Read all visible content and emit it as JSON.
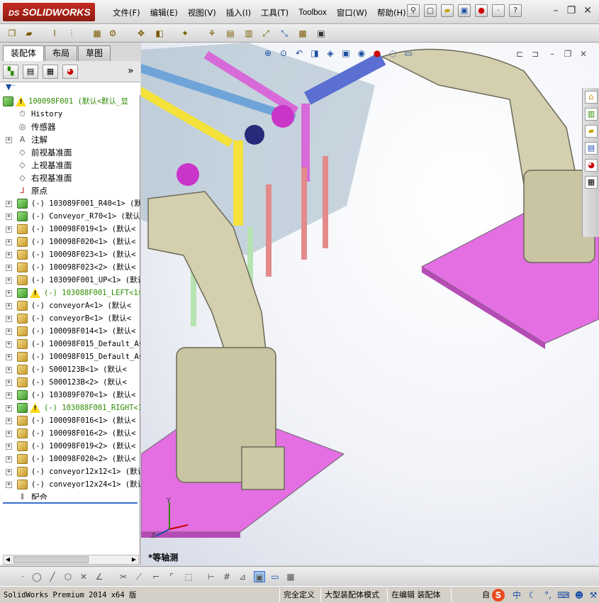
{
  "app": {
    "logo_ds": "DS",
    "logo_text": "SOLIDWORKS"
  },
  "menu": [
    {
      "label": "文件(F)"
    },
    {
      "label": "编辑(E)"
    },
    {
      "label": "视图(V)"
    },
    {
      "label": "插入(I)"
    },
    {
      "label": "工具(T)"
    },
    {
      "label": "Toolbox"
    },
    {
      "label": "窗口(W)"
    },
    {
      "label": "帮助(H)"
    }
  ],
  "panel": {
    "tabs": [
      {
        "label": "装配体"
      },
      {
        "label": "布局"
      },
      {
        "label": "草图"
      }
    ],
    "expand_glyph": "»"
  },
  "tree": {
    "root": "100098F001  (默认<默认_显",
    "items": [
      {
        "label": "History",
        "kind": "history"
      },
      {
        "label": "传感器",
        "kind": "sensor"
      },
      {
        "label": "注解",
        "kind": "annotation",
        "exp": true
      },
      {
        "label": "前视基准面",
        "kind": "plane"
      },
      {
        "label": "上视基准面",
        "kind": "plane"
      },
      {
        "label": "右视基准面",
        "kind": "plane"
      },
      {
        "label": "原点",
        "kind": "origin"
      },
      {
        "label": "(-) 103089F001_R40<1> (默",
        "kind": "asm",
        "exp": true
      },
      {
        "label": "(-) Conveyor_R70<1> (默认",
        "kind": "asm",
        "exp": true
      },
      {
        "label": "(-) 100098F019<1> (默认<",
        "kind": "part",
        "exp": true
      },
      {
        "label": "(-) 100098F020<1> (默认<",
        "kind": "part",
        "exp": true
      },
      {
        "label": "(-) 100098F023<1> (默认<",
        "kind": "part",
        "exp": true
      },
      {
        "label": "(-) 100098F023<2> (默认<",
        "kind": "part",
        "exp": true
      },
      {
        "label": "(-) 103090F001_UP<1> (默认",
        "kind": "part",
        "exp": true
      },
      {
        "label": "(-) 103088F001_LEFT<1>",
        "kind": "warn",
        "exp": true
      },
      {
        "label": "(-) conveyorA<1> (默认<",
        "kind": "part",
        "exp": true
      },
      {
        "label": "(-) conveyorB<1> (默认<",
        "kind": "part",
        "exp": true
      },
      {
        "label": "(-) 100098F014<1> (默认<",
        "kind": "part",
        "exp": true
      },
      {
        "label": "(-) 100098F015_Default_As",
        "kind": "part",
        "exp": true
      },
      {
        "label": "(-) 100098F015_Default_As",
        "kind": "part",
        "exp": true
      },
      {
        "label": "(-) S000123B<1> (默认<",
        "kind": "part",
        "exp": true
      },
      {
        "label": "(-) S000123B<2> (默认<",
        "kind": "part",
        "exp": true
      },
      {
        "label": "(-) 103089F070<1> (默认<",
        "kind": "asm",
        "exp": true
      },
      {
        "label": "(-) 103088F001_RIGHT<1>",
        "kind": "warn",
        "exp": true
      },
      {
        "label": "(-) 100098F016<1> (默认<",
        "kind": "part",
        "exp": true
      },
      {
        "label": "(-) 100098F016<2> (默认<",
        "kind": "part",
        "exp": true
      },
      {
        "label": "(-) 100098F019<2> (默认<",
        "kind": "part",
        "exp": true
      },
      {
        "label": "(-) 100098F020<2> (默认<",
        "kind": "part",
        "exp": true
      },
      {
        "label": "(-) conveyor12x12<1> (默认",
        "kind": "part",
        "exp": true
      },
      {
        "label": "(-) conveyor12x24<1> (默认",
        "kind": "part",
        "exp": true
      },
      {
        "label": "配合",
        "kind": "mates"
      }
    ]
  },
  "viewport": {
    "view_name": "*等轴测"
  },
  "status": {
    "product": "SolidWorks Premium 2014 x64 版",
    "definition": "完全定义",
    "mode": "大型装配体模式",
    "editing": "在编辑 装配体",
    "tray_text": "自",
    "ime_lang": "中"
  },
  "colors": {
    "brand_red": "#b8241a",
    "tree_green": "#2e8b00",
    "floor_pink": "#e36fe3",
    "robot_beige": "#d4cfae"
  }
}
